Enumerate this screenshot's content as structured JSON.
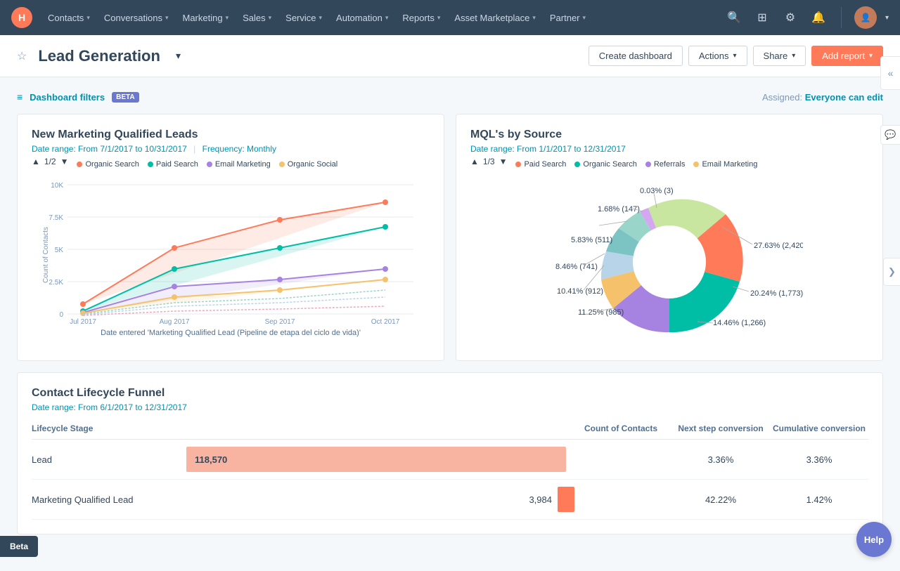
{
  "nav": {
    "logo": "H",
    "items": [
      {
        "label": "Contacts",
        "id": "contacts"
      },
      {
        "label": "Conversations",
        "id": "conversations"
      },
      {
        "label": "Marketing",
        "id": "marketing"
      },
      {
        "label": "Sales",
        "id": "sales"
      },
      {
        "label": "Service",
        "id": "service"
      },
      {
        "label": "Automation",
        "id": "automation"
      },
      {
        "label": "Reports",
        "id": "reports"
      },
      {
        "label": "Asset Marketplace",
        "id": "asset-marketplace"
      },
      {
        "label": "Partner",
        "id": "partner"
      }
    ]
  },
  "header": {
    "title": "Lead Generation",
    "star_label": "☆",
    "create_dashboard": "Create dashboard",
    "actions": "Actions",
    "share": "Share",
    "add_report": "Add report"
  },
  "filter_bar": {
    "label": "Dashboard filters",
    "beta": "BETA",
    "assigned_label": "Assigned:",
    "assigned_value": "Everyone can edit"
  },
  "mql_chart": {
    "title": "New Marketing Qualified Leads",
    "date_range": "Date range: From 7/1/2017 to 10/31/2017",
    "frequency": "Frequency: Monthly",
    "page": "1/2",
    "legend": [
      {
        "label": "Organic Search",
        "color": "#ff7a59"
      },
      {
        "label": "Paid Search",
        "color": "#00bda5"
      },
      {
        "label": "Email Marketing",
        "color": "#a783e1"
      },
      {
        "label": "Organic Social",
        "color": "#f5c26b"
      }
    ],
    "y_axis_label": "Count of Contacts",
    "x_axis_labels": [
      "Jul 2017",
      "Aug 2017",
      "Sep 2017",
      "Oct 2017"
    ],
    "x_axis_note": "Date entered 'Marketing Qualified Lead (Pipeline de etapa del ciclo de vida)'",
    "y_labels": [
      "10K",
      "7.5K",
      "5K",
      "2.5K",
      "0"
    ]
  },
  "mql_source_chart": {
    "title": "MQL's by Source",
    "date_range": "Date range: From 1/1/2017 to 12/31/2017",
    "page": "1/3",
    "legend": [
      {
        "label": "Paid Search",
        "color": "#ff7a59"
      },
      {
        "label": "Organic Search",
        "color": "#00bda5"
      },
      {
        "label": "Referrals",
        "color": "#a783e1"
      },
      {
        "label": "Email Marketing",
        "color": "#f5c26b"
      }
    ],
    "segments": [
      {
        "label": "27.63% (2,420)",
        "color": "#ff7a59",
        "value": 27.63
      },
      {
        "label": "20.24% (1,773)",
        "color": "#00bda5",
        "value": 20.24
      },
      {
        "label": "14.46% (1,266)",
        "color": "#a783e1",
        "value": 14.46
      },
      {
        "label": "11.25% (985)",
        "color": "#f5c26b",
        "value": 11.25
      },
      {
        "label": "10.41% (912)",
        "color": "#b8d4e8",
        "value": 10.41
      },
      {
        "label": "8.46% (741)",
        "color": "#7cc4c4",
        "value": 8.46
      },
      {
        "label": "5.83% (511)",
        "color": "#99d5c9",
        "value": 5.83
      },
      {
        "label": "1.68% (147)",
        "color": "#d4a8f0",
        "value": 1.68
      },
      {
        "label": "0.03% (3)",
        "color": "#c8e6a0",
        "value": 0.03
      }
    ]
  },
  "funnel": {
    "title": "Contact Lifecycle Funnel",
    "date_range": "Date range: From 6/1/2017 to 12/31/2017",
    "headers": [
      "Lifecycle Stage",
      "Count of Contacts",
      "Next step conversion",
      "Cumulative conversion"
    ],
    "rows": [
      {
        "stage": "Lead",
        "count": "118,570",
        "bar_width_pct": 100,
        "bar_color": "#f8b4a0",
        "next_step": "3.36%",
        "cumulative": "3.36%"
      },
      {
        "stage": "Marketing Qualified Lead",
        "count": "3,984",
        "bar_width_pct": 4,
        "bar_color": "#ff7a59",
        "next_step": "42.22%",
        "cumulative": "1.42%"
      }
    ]
  },
  "beta_label": "Beta",
  "help_label": "Help"
}
